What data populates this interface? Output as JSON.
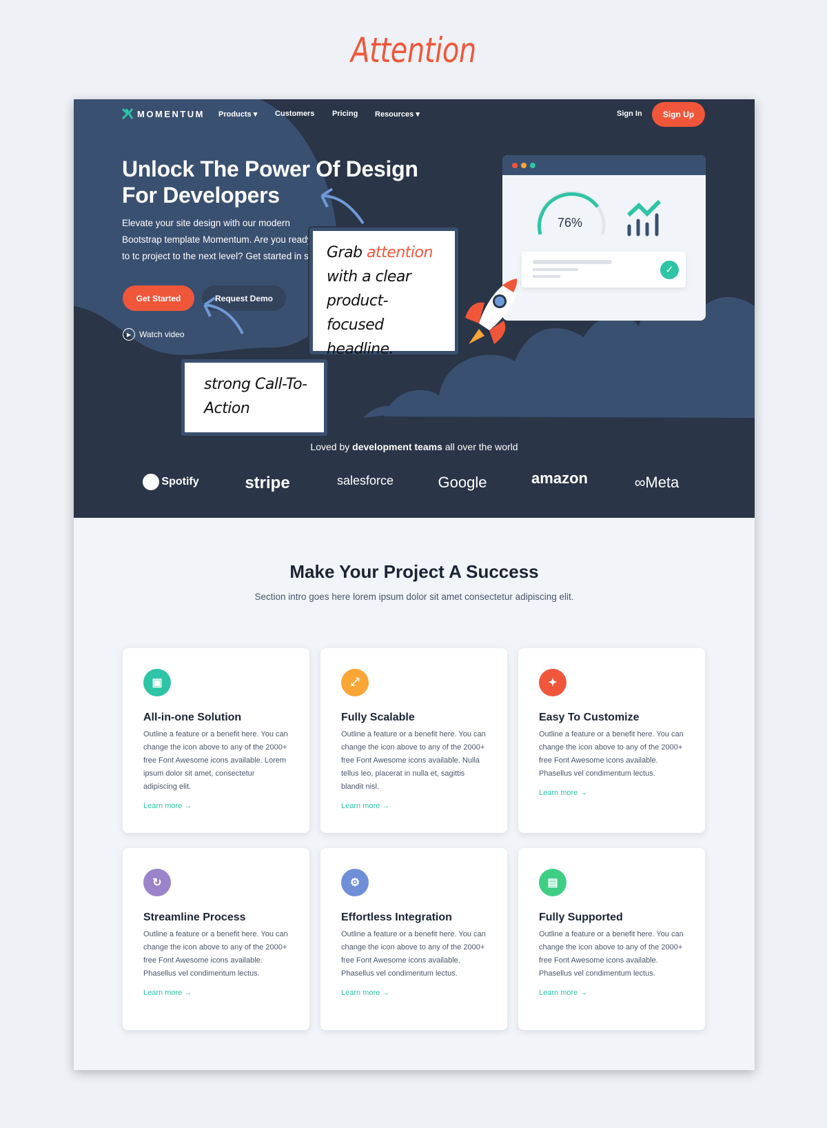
{
  "title": "Attention",
  "nav": {
    "brand": "MOMENTUM",
    "items": [
      "Products",
      "Customers",
      "Pricing",
      "Resources"
    ],
    "sign_in": "Sign In",
    "sign_up": "Sign Up"
  },
  "hero": {
    "headline": "Unlock The Power Of Design For Developers",
    "lead": "Elevate your site design with our modern Bootstrap template Momentum. Are you ready to tc project to the next level? Get started in se",
    "get_started": "Get Started",
    "request_demo": "Request Demo",
    "watch_video": "Watch video",
    "gauge_value": "76%",
    "gauge_percent": 76
  },
  "notes": {
    "headline_pre": "Grab",
    "headline_accent": "attention",
    "headline_post": "with a clear product-focused headline.",
    "cta": "strong Call-To-Action"
  },
  "loved": {
    "pre": "Loved by",
    "bold": "development teams",
    "post": "all over the world"
  },
  "logos": [
    "Spotify",
    "stripe",
    "salesforce",
    "Google",
    "amazon",
    "Meta"
  ],
  "section": {
    "title": "Make Your Project A Success",
    "intro": "Section intro goes here lorem ipsum dolor sit amet consectetur adipiscing elit."
  },
  "colors": {
    "accent": "#f0563a",
    "teal": "#2ec4a6",
    "hero": "#2a3547"
  },
  "features": [
    {
      "title": "All-in-one Solution",
      "icon": "box-icon",
      "color": "#2ec4a6",
      "body": "Outline a feature or a benefit here. You can change the icon above to any of the 2000+ free Font Awesome icons available. Lorem ipsum dolor sit amet, consectetur adipiscing elit.",
      "link": "Learn more →"
    },
    {
      "title": "Fully Scalable",
      "icon": "expand-icon",
      "color": "#f9a636",
      "body": "Outline a feature or a benefit here. You can change the icon above to any of the 2000+ free Font Awesome icons available. Nulla tellus leo, placerat in nulla et, sagittis blandit nisl.",
      "link": "Learn more →"
    },
    {
      "title": "Easy To Customize",
      "icon": "magic-wand-icon",
      "color": "#f0563a",
      "body": "Outline a feature or a benefit here. You can change the icon above to any of the 2000+ free Font Awesome icons available. Phasellus vel condimentum lectus.",
      "link": "Learn more →"
    },
    {
      "title": "Streamline Process",
      "icon": "refresh-icon",
      "color": "#9b84c9",
      "body": "Outline a feature or a benefit here. You can change the icon above to any of the 2000+ free Font Awesome icons available. Phasellus vel condimentum lectus.",
      "link": "Learn more →"
    },
    {
      "title": "Effortless Integration",
      "icon": "cogs-icon",
      "color": "#6f8fd8",
      "body": "Outline a feature or a benefit here. You can change the icon above to any of the 2000+ free Font Awesome icons available. Phasellus vel condimentum lectus.",
      "link": "Learn more →"
    },
    {
      "title": "Fully Supported",
      "icon": "book-icon",
      "color": "#3ecf85",
      "body": "Outline a feature or a benefit here. You can change the icon above to any of the 2000+ free Font Awesome icons available. Phasellus vel condimentum lectus.",
      "link": "Learn more →"
    }
  ]
}
